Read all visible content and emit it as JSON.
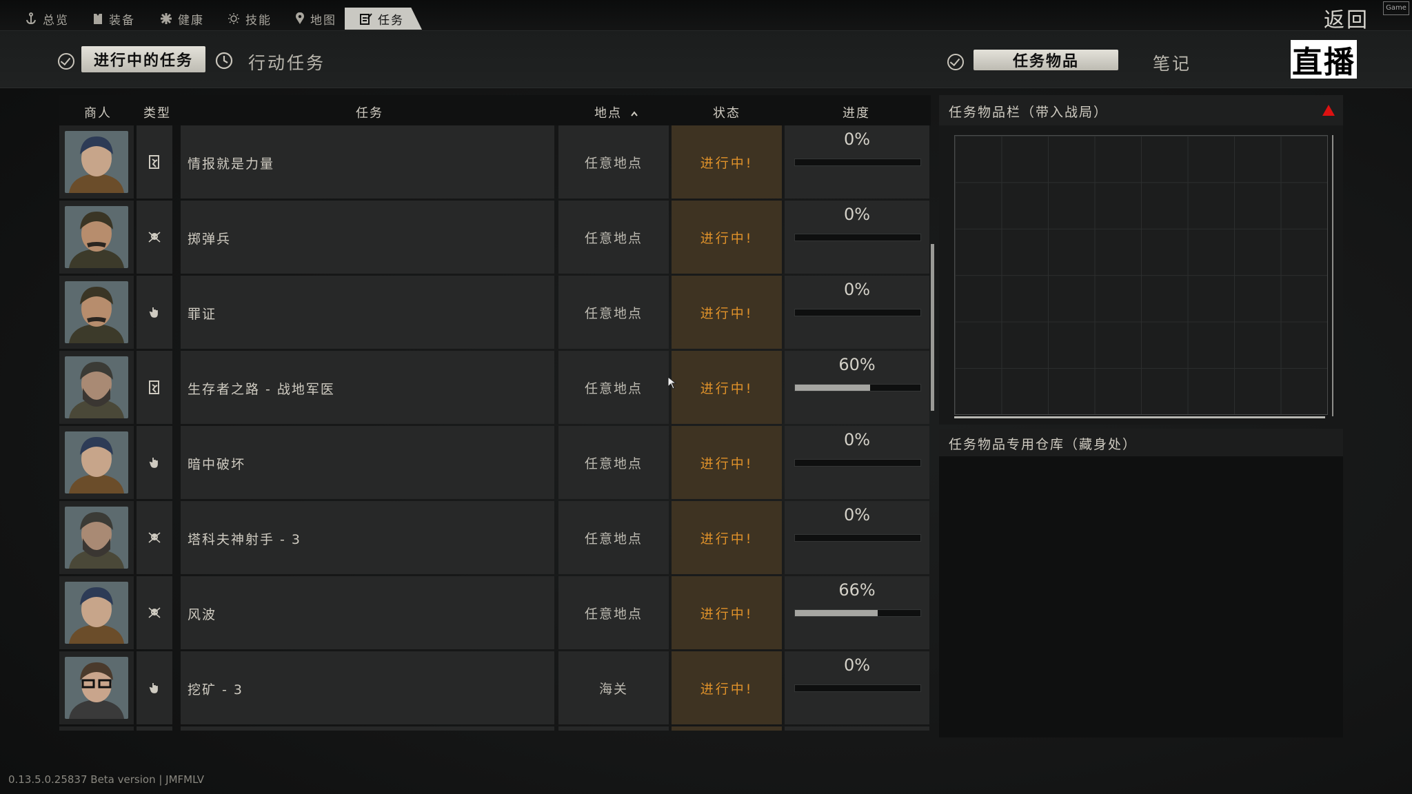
{
  "topnav": {
    "tabs": [
      {
        "label": "总览",
        "icon": "anchor-icon"
      },
      {
        "label": "装备",
        "icon": "vest-icon"
      },
      {
        "label": "健康",
        "icon": "medical-icon"
      },
      {
        "label": "技能",
        "icon": "sun-icon"
      },
      {
        "label": "地图",
        "icon": "map-pin-icon"
      },
      {
        "label": "任务",
        "icon": "task-icon",
        "active": true
      }
    ],
    "back_label": "返回",
    "corner_badge": "Game"
  },
  "subnav": {
    "active_quests_label": "进行中的任务",
    "operational_quests_label": "行动任务",
    "quest_items_label": "任务物品",
    "notes_label": "笔记",
    "live_label": "直播"
  },
  "table": {
    "columns": {
      "trader": "商人",
      "type": "类型",
      "task": "任务",
      "location": "地点",
      "status": "状态",
      "progress": "进度"
    },
    "sort": {
      "column": "location",
      "direction": "ascending"
    },
    "rows": [
      {
        "trader": "Peacekeeper",
        "type_icon": "exit-icon",
        "name": "情报就是力量",
        "location": "任意地点",
        "status": "进行中!",
        "progress_label": "0%",
        "progress": 0
      },
      {
        "trader": "Prapor",
        "type_icon": "skull-icon",
        "name": "掷弹兵",
        "location": "任意地点",
        "status": "进行中!",
        "progress_label": "0%",
        "progress": 0
      },
      {
        "trader": "Prapor",
        "type_icon": "hand-icon",
        "name": "罪证",
        "location": "任意地点",
        "status": "进行中!",
        "progress_label": "0%",
        "progress": 0
      },
      {
        "trader": "Jaeger",
        "type_icon": "exit-icon",
        "name": "生存者之路 - 战地军医",
        "location": "任意地点",
        "status": "进行中!",
        "progress_label": "60%",
        "progress": 0.6
      },
      {
        "trader": "Peacekeeper",
        "type_icon": "hand-icon",
        "name": "暗中破坏",
        "location": "任意地点",
        "status": "进行中!",
        "progress_label": "0%",
        "progress": 0
      },
      {
        "trader": "Jaeger",
        "type_icon": "skull-icon",
        "name": "塔科夫神射手 - 3",
        "location": "任意地点",
        "status": "进行中!",
        "progress_label": "0%",
        "progress": 0
      },
      {
        "trader": "Peacekeeper",
        "type_icon": "skull-icon",
        "name": "风波",
        "location": "任意地点",
        "status": "进行中!",
        "progress_label": "66%",
        "progress": 0.66
      },
      {
        "trader": "Mechanic",
        "type_icon": "hand-icon",
        "name": "挖矿 - 3",
        "location": "海关",
        "status": "进行中!",
        "progress_label": "0%",
        "progress": 0
      }
    ]
  },
  "right": {
    "quest_items_title": "任务物品栏（带入战局）",
    "stash_title": "任务物品专用仓库（藏身处）"
  },
  "footer": {
    "version": "0.13.5.0.25837 Beta version | JMFMLV"
  },
  "colors": {
    "status": "#e0922a",
    "status_bg": "#3e3322",
    "warning": "#dd1111"
  }
}
